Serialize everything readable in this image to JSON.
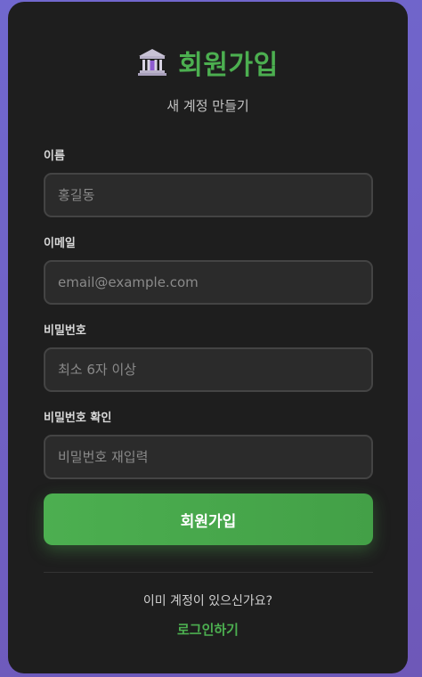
{
  "header": {
    "icon": "bank-icon",
    "title": "회원가입",
    "subtitle": "새 계정 만들기"
  },
  "form": {
    "fields": [
      {
        "label": "이름",
        "placeholder": "홍길동",
        "value": "",
        "type": "text"
      },
      {
        "label": "이메일",
        "placeholder": "email@example.com",
        "value": "",
        "type": "email"
      },
      {
        "label": "비밀번호",
        "placeholder": "최소 6자 이상",
        "value": "",
        "type": "password"
      },
      {
        "label": "비밀번호 확인",
        "placeholder": "비밀번호 재입력",
        "value": "",
        "type": "password"
      }
    ],
    "submit_label": "회원가입"
  },
  "footer": {
    "prompt": "이미 계정이 있으신가요?",
    "login_link": "로그인하기"
  },
  "colors": {
    "accent": "#4caf50",
    "card_background": "#1e1e1e",
    "page_background": "#6e5fc4",
    "input_background": "#2b2b2b",
    "input_border": "#444444"
  }
}
